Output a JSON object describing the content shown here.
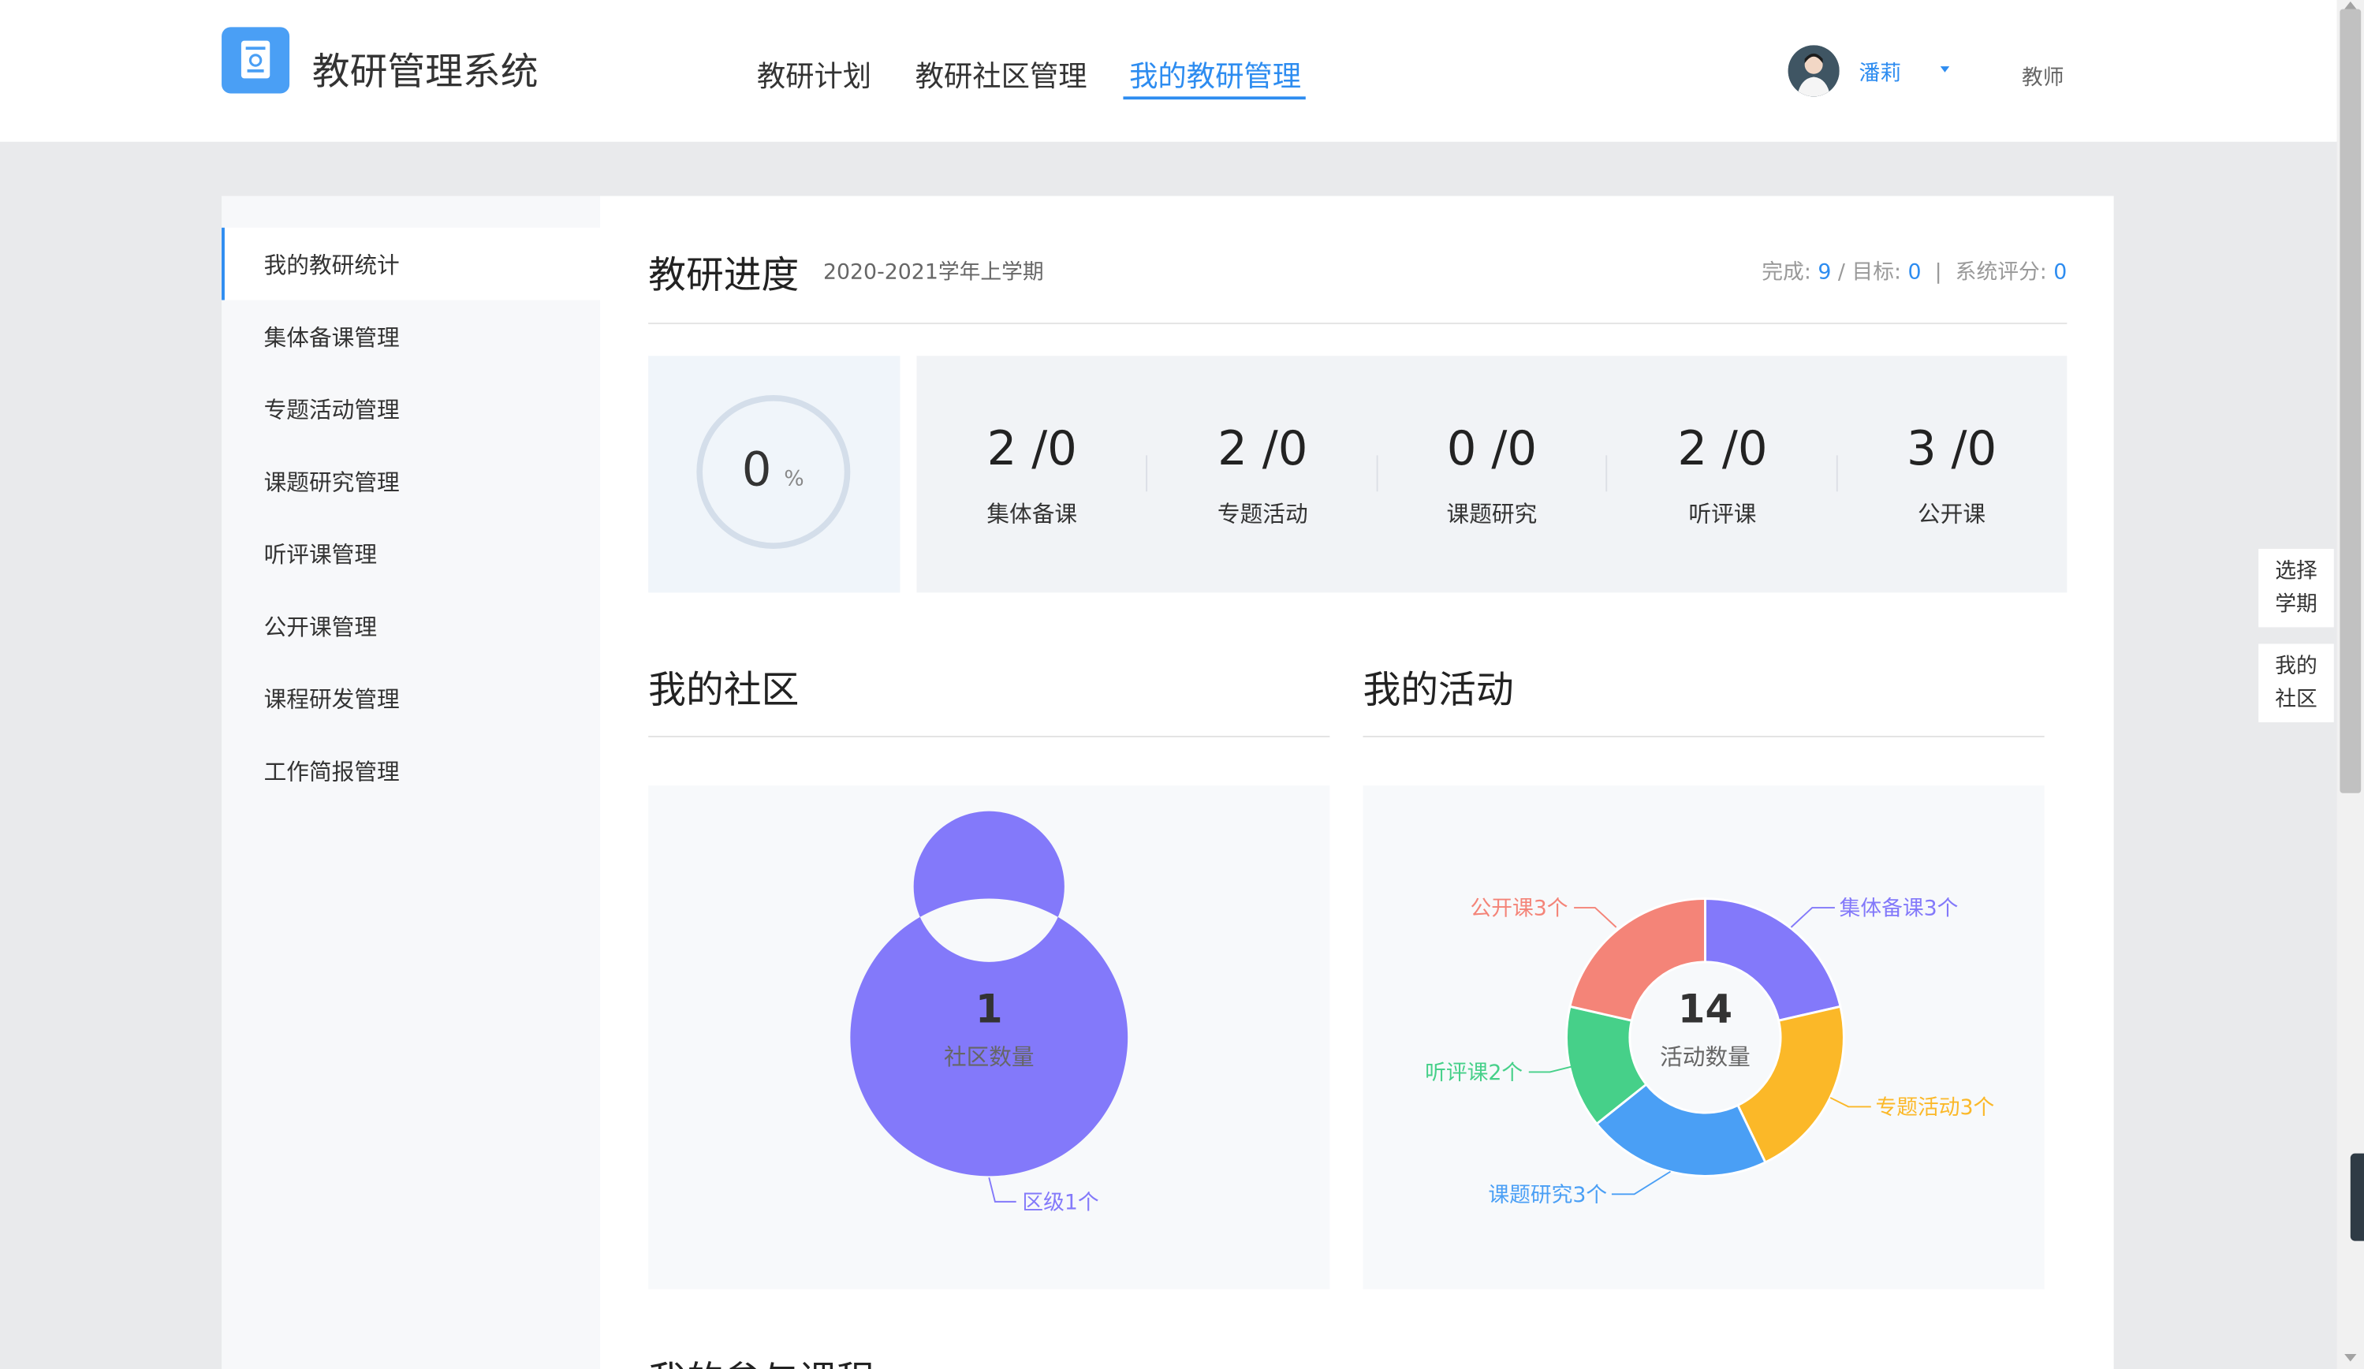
{
  "header": {
    "app_title": "教研管理系统",
    "nav": [
      {
        "label": "教研计划"
      },
      {
        "label": "教研社区管理"
      },
      {
        "label": "我的教研管理"
      }
    ],
    "active_nav": "我的教研管理",
    "user": {
      "name": "潘莉",
      "role": "教师"
    }
  },
  "sidebar": {
    "items": [
      {
        "label": "我的教研统计"
      },
      {
        "label": "集体备课管理"
      },
      {
        "label": "专题活动管理"
      },
      {
        "label": "课题研究管理"
      },
      {
        "label": "听评课管理"
      },
      {
        "label": "公开课管理"
      },
      {
        "label": "课程研发管理"
      },
      {
        "label": "工作简报管理"
      }
    ],
    "active": "我的教研统计"
  },
  "progress": {
    "title": "教研进度",
    "term": "2020-2021学年上学期",
    "summary": {
      "done_label": "完成:",
      "done": "9",
      "target_label": "目标:",
      "target": "0",
      "score_label": "系统评分:",
      "score": "0",
      "slash": "/",
      "bar": "|"
    },
    "percent": "0",
    "percent_unit": "%",
    "stats": [
      {
        "value": "2 /0",
        "label": "集体备课"
      },
      {
        "value": "2 /0",
        "label": "专题活动"
      },
      {
        "value": "0 /0",
        "label": "课题研究"
      },
      {
        "value": "2 /0",
        "label": "听评课"
      },
      {
        "value": "3 /0",
        "label": "公开课"
      }
    ]
  },
  "community": {
    "title": "我的社区",
    "center_value": "1",
    "center_label": "社区数量"
  },
  "activity": {
    "title": "我的活动",
    "center_value": "14",
    "center_label": "活动数量"
  },
  "chart_data": [
    {
      "type": "pie",
      "title": "我的社区",
      "categories": [
        "区级"
      ],
      "values": [
        1
      ],
      "labels": [
        "区级1个"
      ],
      "colors": [
        "#8379fa"
      ],
      "center_text": "1",
      "center_label": "社区数量"
    },
    {
      "type": "pie",
      "title": "我的活动",
      "categories": [
        "集体备课",
        "专题活动",
        "课题研究",
        "听评课",
        "公开课"
      ],
      "values": [
        3,
        3,
        3,
        2,
        3
      ],
      "labels": [
        "集体备课3个",
        "专题活动3个",
        "课题研究3个",
        "听评课2个",
        "公开课3个"
      ],
      "colors": [
        "#8379fa",
        "#fbb828",
        "#4a9ff5",
        "#46d089",
        "#f48478"
      ],
      "center_text": "14",
      "center_label": "活动数量"
    }
  ],
  "float_buttons": [
    {
      "line1": "选择",
      "line2": "学期"
    },
    {
      "line1": "我的",
      "line2": "社区"
    }
  ],
  "next_section_title": "我的参与课程"
}
